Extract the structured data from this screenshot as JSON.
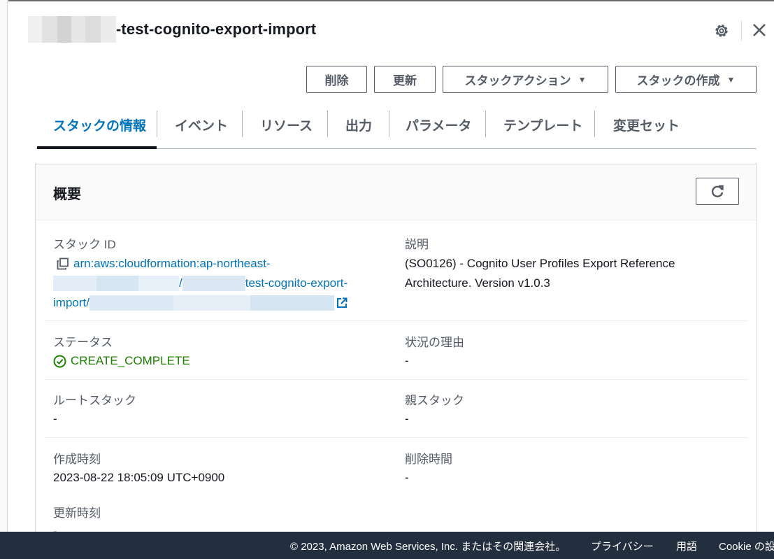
{
  "header": {
    "title_suffix": "-test-cognito-export-import",
    "settings_icon": "gear-icon",
    "close_icon": "close-icon"
  },
  "actions": {
    "delete": "削除",
    "update": "更新",
    "stack_actions": "スタックアクション",
    "create_stack": "スタックの作成"
  },
  "tabs": [
    {
      "label": "スタックの情報",
      "active": true
    },
    {
      "label": "イベント"
    },
    {
      "label": "リソース"
    },
    {
      "label": "出力"
    },
    {
      "label": "パラメータ"
    },
    {
      "label": "テンプレート"
    },
    {
      "label": "変更セット"
    }
  ],
  "overview": {
    "title": "概要",
    "stack_id_label": "スタック ID",
    "stack_id_line1": "arn:aws:cloudformation:ap-northeast-",
    "stack_id_line2_slash": "/",
    "stack_id_line2_suffix": "test-cognito-export-",
    "stack_id_line3": "import/",
    "description_label": "説明",
    "description_line1": "(SO0126) - Cognito User Profiles Export Reference",
    "description_line2": "Architecture. Version v1.0.3",
    "status_label": "ステータス",
    "status_value": "CREATE_COMPLETE",
    "status_reason_label": "状況の理由",
    "status_reason_value": "-",
    "root_stack_label": "ルートスタック",
    "root_stack_value": "-",
    "parent_stack_label": "親スタック",
    "parent_stack_value": "-",
    "created_label": "作成時刻",
    "created_value": "2023-08-22 18:05:09 UTC+0900",
    "deleted_label": "削除時間",
    "deleted_value": "-",
    "updated_label": "更新時刻",
    "updated_value": "-"
  },
  "footer": {
    "copyright": "© 2023, Amazon Web Services, Inc. またはその関連会社。",
    "privacy": "プライバシー",
    "terms": "用語",
    "cookie": "Cookie の設"
  },
  "colors": {
    "link": "#0073bb",
    "success": "#1d8102",
    "footer_bg": "#232f3e"
  }
}
